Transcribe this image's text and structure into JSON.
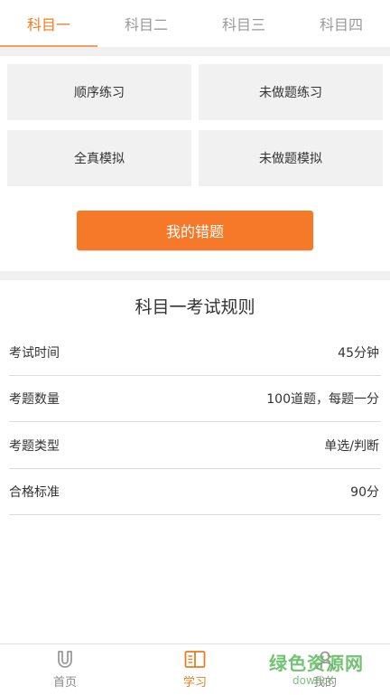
{
  "tabs": [
    "科目一",
    "科目二",
    "科目三",
    "科目四"
  ],
  "practice": {
    "sequence": "顺序练习",
    "unanswered_practice": "未做题练习",
    "full_mock": "全真模拟",
    "unanswered_mock": "未做题模拟"
  },
  "mistakes_button": "我的错题",
  "rules": {
    "title": "科目一考试规则",
    "rows": [
      {
        "label": "考试时间",
        "value": "45分钟"
      },
      {
        "label": "考题数量",
        "value": "100道题，每题一分"
      },
      {
        "label": "考题类型",
        "value": "单选/判断"
      },
      {
        "label": "合格标准",
        "value": "90分"
      }
    ]
  },
  "bottom_nav": {
    "home": "首页",
    "study": "学习",
    "mine": "我的"
  },
  "watermark": {
    "text": "绿色资源网",
    "url": "downcc"
  },
  "colors": {
    "accent": "#f6792a",
    "active_tab": "#f07a1e",
    "watermark": "#5bb85b"
  }
}
